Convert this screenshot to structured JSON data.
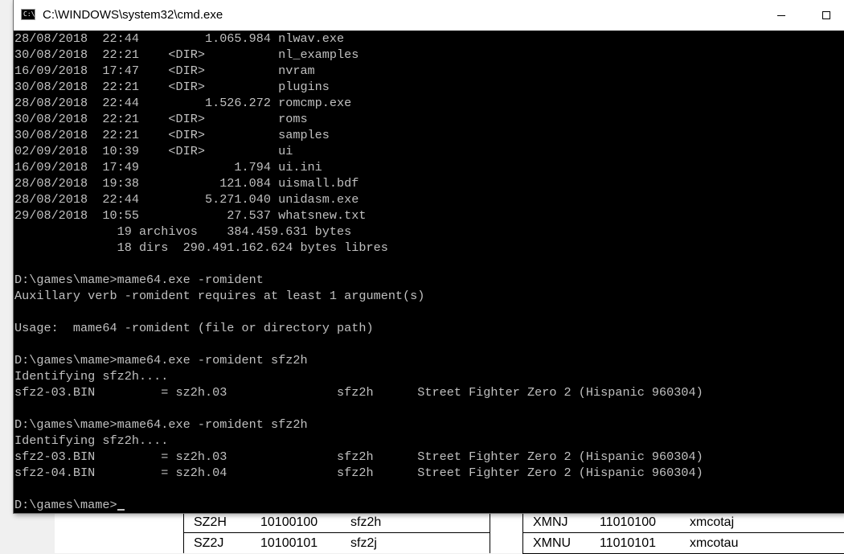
{
  "window": {
    "title": "C:\\WINDOWS\\system32\\cmd.exe",
    "icon": "cmd-icon"
  },
  "console": {
    "lines": [
      "28/08/2018  22:44         1.065.984 nlwav.exe",
      "30/08/2018  22:21    <DIR>          nl_examples",
      "16/09/2018  17:47    <DIR>          nvram",
      "30/08/2018  22:21    <DIR>          plugins",
      "28/08/2018  22:44         1.526.272 romcmp.exe",
      "30/08/2018  22:21    <DIR>          roms",
      "30/08/2018  22:21    <DIR>          samples",
      "02/09/2018  10:39    <DIR>          ui",
      "16/09/2018  17:49             1.794 ui.ini",
      "28/08/2018  19:38           121.084 uismall.bdf",
      "28/08/2018  22:44         5.271.040 unidasm.exe",
      "29/08/2018  10:55            27.537 whatsnew.txt",
      "              19 archivos    384.459.631 bytes",
      "              18 dirs  290.491.162.624 bytes libres",
      "",
      "D:\\games\\mame>mame64.exe -romident",
      "Auxillary verb -romident requires at least 1 argument(s)",
      "",
      "Usage:  mame64 -romident (file or directory path)",
      "",
      "D:\\games\\mame>mame64.exe -romident sfz2h",
      "Identifying sfz2h....",
      "sfz2-03.BIN         = sz2h.03               sfz2h      Street Fighter Zero 2 (Hispanic 960304)",
      "",
      "D:\\games\\mame>mame64.exe -romident sfz2h",
      "Identifying sfz2h....",
      "sfz2-03.BIN         = sz2h.03               sfz2h      Street Fighter Zero 2 (Hispanic 960304)",
      "sfz2-04.BIN         = sz2h.04               sfz2h      Street Fighter Zero 2 (Hispanic 960304)",
      "",
      "D:\\games\\mame>"
    ]
  },
  "background_doc": {
    "left_table": [
      [
        "SZ2H",
        "10100100",
        "sfz2h"
      ],
      [
        "SZ2J",
        "10100101",
        "sfz2j"
      ]
    ],
    "right_table": [
      [
        "XMNJ",
        "11010100",
        "xmcotaj"
      ],
      [
        "XMNU",
        "11010101",
        "xmcotau"
      ]
    ]
  }
}
